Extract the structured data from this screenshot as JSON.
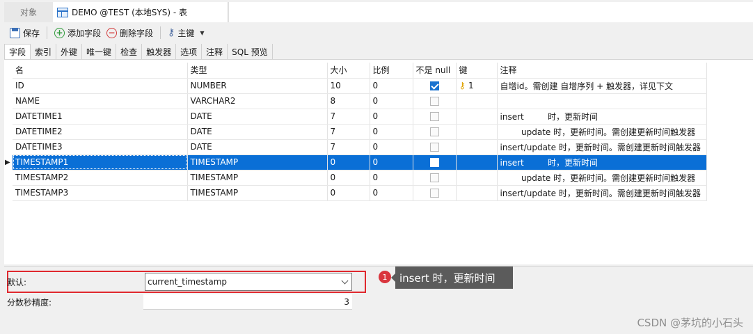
{
  "window": {
    "objects_tab": "对象",
    "active_tab": "DEMO @TEST (本地SYS) - 表"
  },
  "toolbar": {
    "save": "保存",
    "add_field": "添加字段",
    "delete_field": "删除字段",
    "primary_key": "主键"
  },
  "subtabs": [
    "字段",
    "索引",
    "外键",
    "唯一键",
    "检查",
    "触发器",
    "选项",
    "注释",
    "SQL 预览"
  ],
  "grid": {
    "headers": {
      "name": "名",
      "type": "类型",
      "size": "大小",
      "scale": "比例",
      "not_null": "不是 null",
      "key": "键",
      "comment": "注释"
    },
    "rows": [
      {
        "name": "ID",
        "type": "NUMBER",
        "size": "10",
        "scale": "0",
        "not_null": true,
        "key": "1",
        "comment": "自增id。需创建 自增序列 + 触发器，详见下文"
      },
      {
        "name": "NAME",
        "type": "VARCHAR2",
        "size": "8",
        "scale": "0",
        "not_null": false,
        "key": "",
        "comment": ""
      },
      {
        "name": "DATETIME1",
        "type": "DATE",
        "size": "7",
        "scale": "0",
        "not_null": false,
        "key": "",
        "comment": "insert         时，更新时间"
      },
      {
        "name": "DATETIME2",
        "type": "DATE",
        "size": "7",
        "scale": "0",
        "not_null": false,
        "key": "",
        "comment": "        update 时，更新时间。需创建更新时间触发器"
      },
      {
        "name": "DATETIME3",
        "type": "DATE",
        "size": "7",
        "scale": "0",
        "not_null": false,
        "key": "",
        "comment": "insert/update 时，更新时间。需创建更新时间触发器"
      },
      {
        "name": "TIMESTAMP1",
        "type": "TIMESTAMP",
        "size": "0",
        "scale": "0",
        "not_null": false,
        "key": "",
        "comment": "insert         时，更新时间",
        "selected": true
      },
      {
        "name": "TIMESTAMP2",
        "type": "TIMESTAMP",
        "size": "0",
        "scale": "0",
        "not_null": false,
        "key": "",
        "comment": "        update 时，更新时间。需创建更新时间触发器"
      },
      {
        "name": "TIMESTAMP3",
        "type": "TIMESTAMP",
        "size": "0",
        "scale": "0",
        "not_null": false,
        "key": "",
        "comment": "insert/update 时，更新时间。需创建更新时间触发器"
      }
    ]
  },
  "properties": {
    "default_label": "默认:",
    "default_value": "current_timestamp",
    "precision_label": "分数秒精度:",
    "precision_value": "3"
  },
  "annotation": {
    "badge": "1",
    "text": "insert 时，更新时间"
  },
  "watermark": "CSDN @茅坑的小石头",
  "colors": {
    "selection": "#0a6fd6",
    "highlight_box": "#e0282e",
    "tooltip_bg": "#5b5b5b"
  }
}
